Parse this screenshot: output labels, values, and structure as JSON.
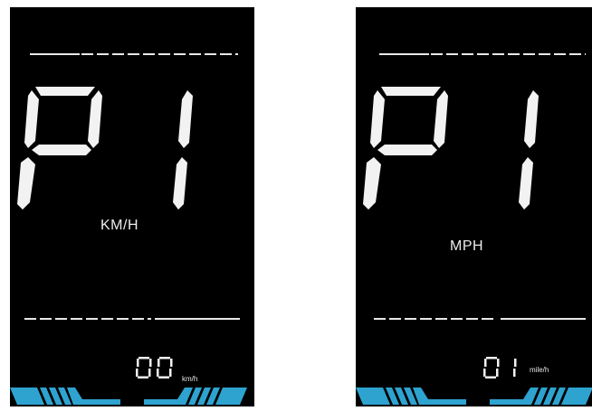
{
  "colors": {
    "segment": "#f2f2f2",
    "accent": "#2ea3d0",
    "background": "#000000"
  },
  "displays": [
    {
      "mode_code": "P1",
      "unit_label": "KM/H",
      "speed_value": "00",
      "speed_unit": "km/h"
    },
    {
      "mode_code": "P1",
      "unit_label": "MPH",
      "speed_value": "01",
      "speed_unit": "mile/h"
    }
  ]
}
